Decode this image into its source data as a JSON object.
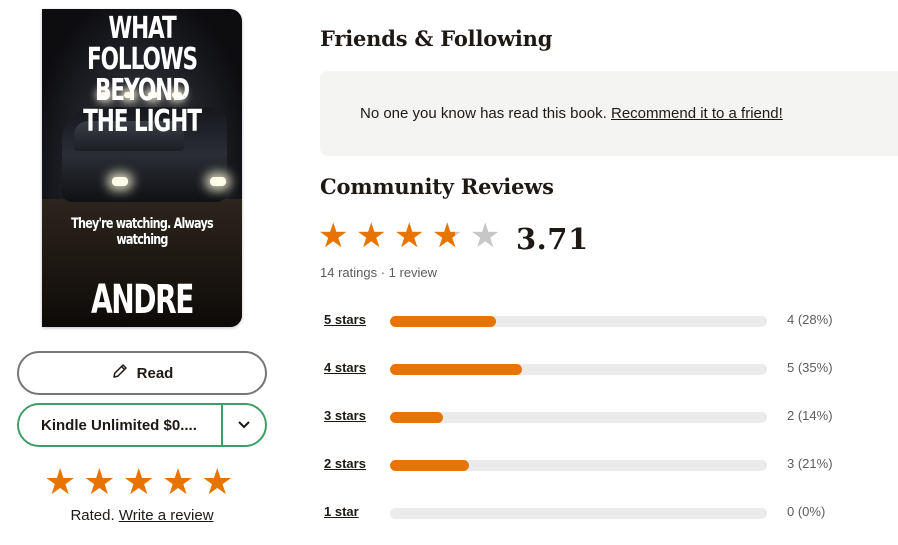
{
  "cover": {
    "title_line1": "WHAT FOLLOWS",
    "title_line2": "BEYOND THE LIGHT",
    "tagline": "They're watching. Always watching",
    "author": "ANDRE SIERRA"
  },
  "actions": {
    "read_label": "Read",
    "kindle_label": "Kindle Unlimited $0....",
    "accent_color": "#409d69"
  },
  "user_rating": {
    "stars": 5,
    "rated_text": "Rated.",
    "write_review_label": "Write a review"
  },
  "friends": {
    "title": "Friends & Following",
    "message": "No one you know has read this book.",
    "recommend_link": "Recommend it to a friend!"
  },
  "community": {
    "title": "Community Reviews",
    "average": "3.71",
    "average_value": 3.71,
    "meta": "14 ratings · 1 review",
    "star_color": "#e87400",
    "histogram": [
      {
        "label": "5 stars",
        "count": "4 (28%)",
        "percent": 28
      },
      {
        "label": "4 stars",
        "count": "5 (35%)",
        "percent": 35
      },
      {
        "label": "3 stars",
        "count": "2 (14%)",
        "percent": 14
      },
      {
        "label": "2 stars",
        "count": "3 (21%)",
        "percent": 21
      },
      {
        "label": "1 star",
        "count": "0 (0%)",
        "percent": 0
      }
    ]
  }
}
